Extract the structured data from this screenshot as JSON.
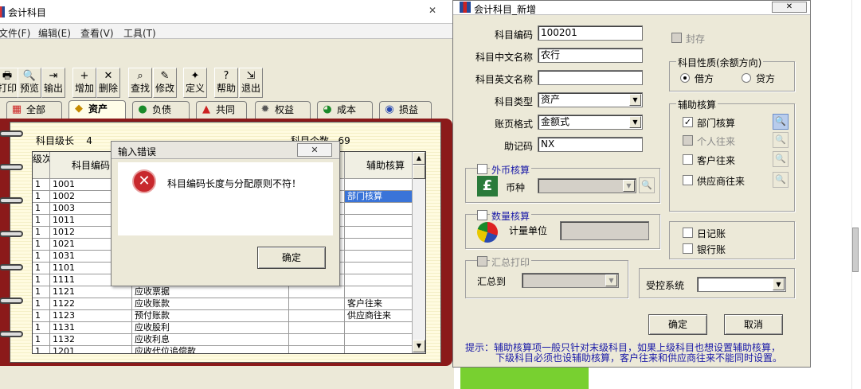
{
  "main_window": {
    "title": "会计科目",
    "close_glyph": "✕",
    "menus": [
      "文件(F)",
      "编辑(E)",
      "查看(V)",
      "工具(T)"
    ],
    "toolbar": [
      {
        "label": "打印",
        "icon": "printer-icon",
        "glyph": "🖶"
      },
      {
        "label": "预览",
        "icon": "preview-icon",
        "glyph": "🔍"
      },
      {
        "label": "输出",
        "icon": "export-icon",
        "glyph": "⇥"
      },
      {
        "label": "增加",
        "icon": "add-icon",
        "glyph": "+"
      },
      {
        "label": "删除",
        "icon": "delete-icon",
        "glyph": "✕"
      },
      {
        "label": "查找",
        "icon": "find-icon",
        "glyph": "⌕"
      },
      {
        "label": "修改",
        "icon": "edit-icon",
        "glyph": "✎"
      },
      {
        "label": "定义",
        "icon": "define-icon",
        "glyph": "✦"
      },
      {
        "label": "帮助",
        "icon": "help-icon",
        "glyph": "?"
      },
      {
        "label": "退出",
        "icon": "exit-icon",
        "glyph": "⇲"
      }
    ],
    "tabs": [
      {
        "label": "全部",
        "icon": "all-icon",
        "glyph": "▦",
        "active": false
      },
      {
        "label": "资产",
        "icon": "asset-icon",
        "glyph": "◆",
        "active": true
      },
      {
        "label": "负债",
        "icon": "liability-icon",
        "glyph": "●",
        "active": false
      },
      {
        "label": "共同",
        "icon": "common-icon",
        "glyph": "▲",
        "active": false
      },
      {
        "label": "权益",
        "icon": "equity-icon",
        "glyph": "✹",
        "active": false
      },
      {
        "label": "成本",
        "icon": "cost-icon",
        "glyph": "◕",
        "active": false
      },
      {
        "label": "损益",
        "icon": "profit-loss-icon",
        "glyph": "◉",
        "active": false
      }
    ],
    "level_label": "科目级长",
    "level_value": "4",
    "count_label": "科目个数",
    "count_value": "69",
    "grid": {
      "headers": [
        "级次",
        "科目编码",
        "",
        "",
        "",
        "辅助核算"
      ],
      "rows": [
        {
          "level": "1",
          "code": "1001",
          "name": "",
          "aux": ""
        },
        {
          "level": "1",
          "code": "1002",
          "name": "",
          "aux": "部门核算"
        },
        {
          "level": "1",
          "code": "1003",
          "name": "",
          "aux": ""
        },
        {
          "level": "1",
          "code": "1011",
          "name": "",
          "aux": ""
        },
        {
          "level": "1",
          "code": "1012",
          "name": "",
          "aux": ""
        },
        {
          "level": "1",
          "code": "1021",
          "name": "",
          "aux": ""
        },
        {
          "level": "1",
          "code": "1031",
          "name": "",
          "aux": ""
        },
        {
          "level": "1",
          "code": "1101",
          "name": "",
          "aux": ""
        },
        {
          "level": "1",
          "code": "1111",
          "name": "",
          "aux": ""
        },
        {
          "level": "1",
          "code": "1121",
          "name": "应收票据",
          "aux": ""
        },
        {
          "level": "1",
          "code": "1122",
          "name": "应收账款",
          "aux": "客户往来"
        },
        {
          "level": "1",
          "code": "1123",
          "name": "预付账款",
          "aux": "供应商往来"
        },
        {
          "level": "1",
          "code": "1131",
          "name": "应收股利",
          "aux": ""
        },
        {
          "level": "1",
          "code": "1132",
          "name": "应收利息",
          "aux": ""
        },
        {
          "level": "1",
          "code": "1201",
          "name": "应收代位追偿款",
          "aux": ""
        }
      ]
    }
  },
  "error_dialog": {
    "title": "输入错误",
    "close_glyph": "✕",
    "icon_glyph": "✕",
    "message": "科目编码长度与分配原则不符！",
    "ok_label": "确定"
  },
  "new_account_dialog": {
    "title": "会计科目_新增",
    "close_glyph": "✕",
    "code_label": "科目编码",
    "code_value": "100201",
    "cn_name_label": "科目中文名称",
    "cn_name_value": "农行",
    "en_name_label": "科目英文名称",
    "en_name_value": "",
    "type_label": "科目类型",
    "type_value": "资产",
    "format_label": "账页格式",
    "format_value": "金额式",
    "mnemonic_label": "助记码",
    "mnemonic_value": "NX",
    "sealed_label": "封存",
    "nature_group": "科目性质(余额方向)",
    "debit_label": "借方",
    "credit_label": "贷方",
    "aux_group": "辅助核算",
    "aux_items": [
      {
        "label": "部门核算",
        "checked": true,
        "enabled": true
      },
      {
        "label": "个人往来",
        "checked": false,
        "enabled": false
      },
      {
        "label": "客户往来",
        "checked": false,
        "enabled": true
      },
      {
        "label": "供应商往来",
        "checked": false,
        "enabled": true
      }
    ],
    "fx_label": "外币核算",
    "currency_label": "币种",
    "qty_label": "数量核算",
    "unit_label": "计量单位",
    "summary_label": "汇总打印",
    "summary_to_label": "汇总到",
    "daybook_label": "日记账",
    "bankbook_label": "银行账",
    "controlled_label": "受控系统",
    "ok_label": "确定",
    "cancel_label": "取消",
    "hint_line1": "提示：辅助核算项一般只针对末级科目，如果上级科目也想设置辅助核算，",
    "hint_line2": "下级科目必须也设辅助核算，客户往来和供应商往来不能同时设置。",
    "check_glyph": "✓",
    "search_glyph": "🔍",
    "dropdown_glyph": "▼"
  }
}
